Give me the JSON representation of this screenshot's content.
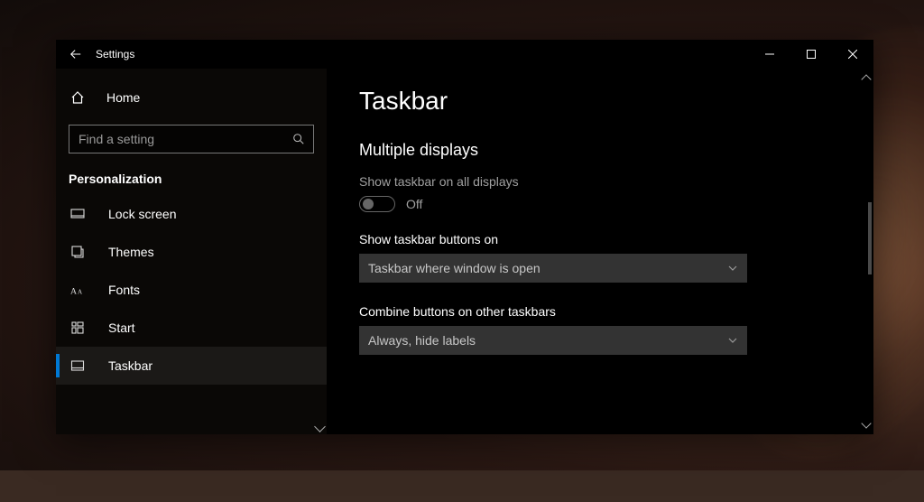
{
  "window": {
    "title": "Settings"
  },
  "sidebar": {
    "home_label": "Home",
    "search_placeholder": "Find a setting",
    "category_label": "Personalization",
    "items": [
      {
        "label": "Lock screen",
        "icon": "lock-screen-icon"
      },
      {
        "label": "Themes",
        "icon": "themes-icon"
      },
      {
        "label": "Fonts",
        "icon": "fonts-icon"
      },
      {
        "label": "Start",
        "icon": "start-icon"
      },
      {
        "label": "Taskbar",
        "icon": "taskbar-icon"
      }
    ],
    "selected_index": 4
  },
  "page": {
    "title": "Taskbar",
    "section_title": "Multiple displays",
    "settings": {
      "show_all_displays": {
        "label": "Show taskbar on all displays",
        "state": "Off",
        "enabled": false
      },
      "show_buttons_on": {
        "label": "Show taskbar buttons on",
        "value": "Taskbar where window is open"
      },
      "combine_other": {
        "label": "Combine buttons on other taskbars",
        "value": "Always, hide labels"
      }
    }
  }
}
